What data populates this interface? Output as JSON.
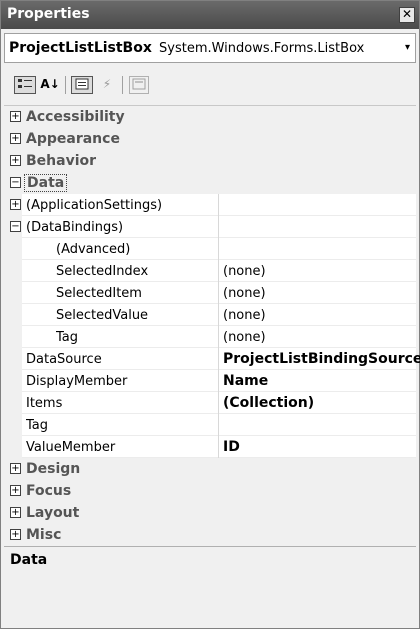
{
  "window": {
    "title": "Properties",
    "close_glyph": "✕"
  },
  "object_selector": {
    "name": "ProjectListListBox",
    "type": "System.Windows.Forms.ListBox",
    "dropdown_glyph": "▾"
  },
  "toolbar": {
    "categorized_icon": "categorized-icon",
    "alphabetical_label": "A↓",
    "properties_icon": "properties-icon",
    "events_glyph": "⚡",
    "property_pages_icon": "property-pages-icon"
  },
  "grid": {
    "rows": [
      {
        "kind": "category",
        "label": "Accessibility",
        "expanded": false
      },
      {
        "kind": "category",
        "label": "Appearance",
        "expanded": false
      },
      {
        "kind": "category",
        "label": "Behavior",
        "expanded": false
      },
      {
        "kind": "category",
        "label": "Data",
        "expanded": true,
        "selected": true
      },
      {
        "kind": "property",
        "name": "(ApplicationSettings)",
        "value": "",
        "expander": "+"
      },
      {
        "kind": "property",
        "name": "(DataBindings)",
        "value": "",
        "expander": "−"
      },
      {
        "kind": "subproperty",
        "name": "(Advanced)",
        "value": ""
      },
      {
        "kind": "subproperty",
        "name": "SelectedIndex",
        "value": "(none)"
      },
      {
        "kind": "subproperty",
        "name": "SelectedItem",
        "value": "(none)"
      },
      {
        "kind": "subproperty",
        "name": "SelectedValue",
        "value": "(none)"
      },
      {
        "kind": "subproperty",
        "name": "Tag",
        "value": "(none)"
      },
      {
        "kind": "property",
        "name": "DataSource",
        "value": "ProjectListBindingSource",
        "bold": true
      },
      {
        "kind": "property",
        "name": "DisplayMember",
        "value": "Name",
        "bold": true
      },
      {
        "kind": "property",
        "name": "Items",
        "value": "(Collection)",
        "bold": true
      },
      {
        "kind": "property",
        "name": "Tag",
        "value": ""
      },
      {
        "kind": "property",
        "name": "ValueMember",
        "value": "ID",
        "bold": true
      },
      {
        "kind": "category",
        "label": "Design",
        "expanded": false
      },
      {
        "kind": "category",
        "label": "Focus",
        "expanded": false
      },
      {
        "kind": "category",
        "label": "Layout",
        "expanded": false
      },
      {
        "kind": "category",
        "label": "Misc",
        "expanded": false
      }
    ]
  },
  "description": {
    "title": "Data"
  }
}
